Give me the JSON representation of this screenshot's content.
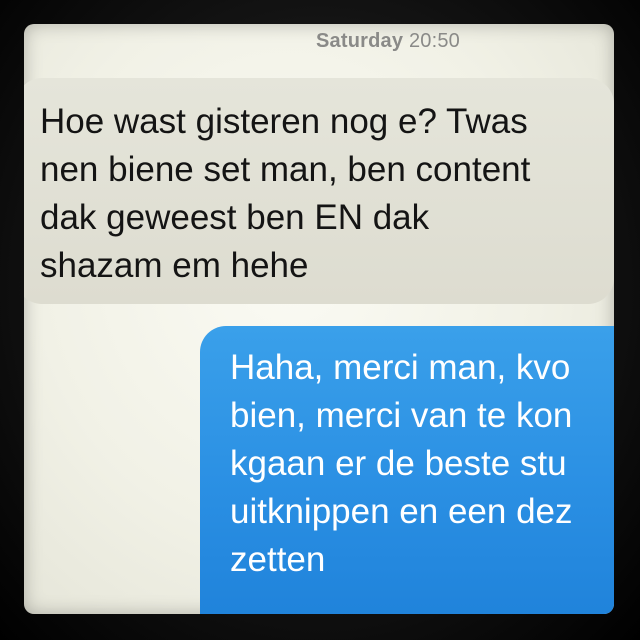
{
  "header": {
    "timestamp_day": "Saturday",
    "timestamp_time": "20:50"
  },
  "messages": [
    {
      "direction": "incoming",
      "text": "Hoe wast gisteren nog e? Twas\nnen biene set man, ben content\ndak geweest ben EN dak\nshazam em hehe"
    },
    {
      "direction": "outgoing",
      "text": "Haha, merci man, kvo\nbien, merci van te kon\nkgaan er de beste stu\nuitknippen en een dez\nzetten"
    }
  ],
  "colors": {
    "incoming_bubble": "#e2e2d7",
    "outgoing_bubble": "#2a8fe3",
    "timestamp_text": "#8a8a88"
  }
}
